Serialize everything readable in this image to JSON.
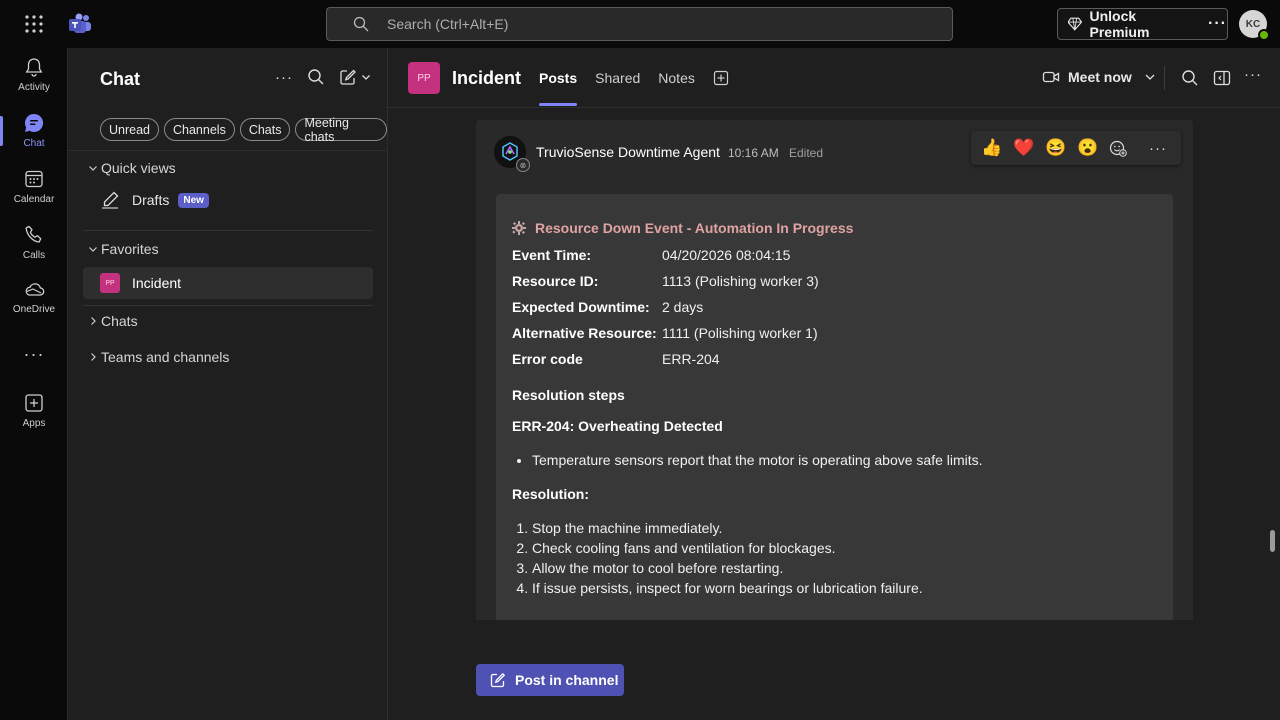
{
  "titlebar": {
    "search_placeholder": "Search (Ctrl+Alt+E)",
    "premium_label": "Unlock Premium",
    "more_glyph": "···",
    "user_initials": "KC"
  },
  "rail": {
    "items": [
      {
        "label": "Activity",
        "icon": "bell-icon"
      },
      {
        "label": "Chat",
        "icon": "chat-icon"
      },
      {
        "label": "Calendar",
        "icon": "calendar-icon"
      },
      {
        "label": "Calls",
        "icon": "phone-icon"
      },
      {
        "label": "OneDrive",
        "icon": "cloud-icon"
      },
      {
        "label": "Apps",
        "icon": "add-app-icon"
      }
    ],
    "more_glyph": "···"
  },
  "panel": {
    "title": "Chat",
    "more_glyph": "···",
    "filters": [
      "Unread",
      "Channels",
      "Chats",
      "Meeting chats"
    ],
    "quick_views": "Quick views",
    "drafts": "Drafts",
    "new_badge": "New",
    "favorites": "Favorites",
    "incident_initials": "PP",
    "incident": "Incident",
    "chats": "Chats",
    "teams": "Teams and channels"
  },
  "header": {
    "initials": "PP",
    "title": "Incident",
    "tabs": [
      "Posts",
      "Shared",
      "Notes"
    ],
    "meet_label": "Meet now",
    "more_glyph": "···"
  },
  "message": {
    "sender": "TruvioSense Downtime Agent",
    "time": "10:16 AM",
    "edited": "Edited",
    "reactions": [
      "👍",
      "❤️",
      "😆",
      "😮"
    ],
    "more_glyph": "···",
    "card": {
      "title": "Resource Down Event - Automation In Progress",
      "fields": [
        {
          "k": "Event Time:",
          "v": "04/20/2026 08:04:15"
        },
        {
          "k": "Resource ID:",
          "v": "1113 (Polishing worker 3)"
        },
        {
          "k": "Expected Downtime:",
          "v": "2 days"
        },
        {
          "k": "Alternative Resource:",
          "v": "1111 (Polishing worker 1)"
        },
        {
          "k": "Error code",
          "v": "ERR-204"
        }
      ],
      "resolution_steps": "Resolution steps",
      "error_heading": "ERR-204: Overheating Detected",
      "bullets": [
        "Temperature sensors report that the motor is operating above safe limits."
      ],
      "resolution_heading": "Resolution:",
      "steps": [
        "Stop the machine immediately.",
        "Check cooling fans and ventilation for blockages.",
        "Allow the motor to cool before restarting.",
        "If issue persists, inspect for worn bearings or lubrication failure."
      ]
    }
  },
  "compose": {
    "post_label": "Post in channel"
  },
  "colors": {
    "accent": "#7f85f5",
    "button": "#4f52b2",
    "pp_tile": "#c4317e",
    "card_title": "#e0a3a3"
  }
}
